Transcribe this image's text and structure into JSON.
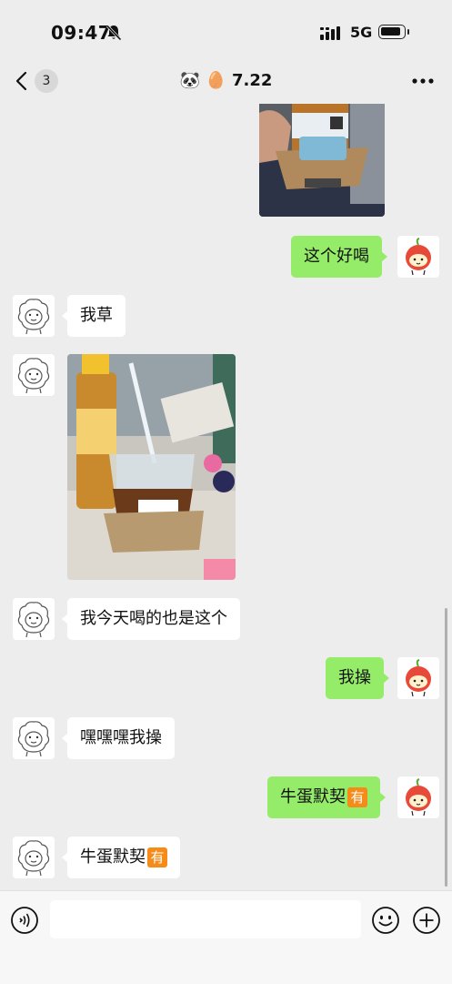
{
  "status_bar": {
    "time": "09:47",
    "network": "5G",
    "battery_level": 0.9
  },
  "nav": {
    "unread_count": "3",
    "title": "🐼 🥚 7.22"
  },
  "messages": [
    {
      "side": "right",
      "type": "text",
      "text": "这个好喝"
    },
    {
      "side": "left",
      "type": "text",
      "text": "我草"
    },
    {
      "side": "left",
      "type": "image"
    },
    {
      "side": "left",
      "type": "text",
      "text": "我今天喝的也是这个"
    },
    {
      "side": "right",
      "type": "text",
      "text": "我操"
    },
    {
      "side": "left",
      "type": "text",
      "text": "嘿嘿嘿我操"
    },
    {
      "side": "right",
      "type": "text",
      "text": "牛蛋默契",
      "emoji": "有"
    },
    {
      "side": "left",
      "type": "text",
      "text": "牛蛋默契",
      "emoji": "有"
    }
  ],
  "input": {
    "value": "",
    "placeholder": ""
  },
  "colors": {
    "background": "#ededed",
    "sent_bubble": "#95ec69",
    "received_bubble": "#ffffff",
    "accent_emoji": "#f58b18"
  },
  "icons": [
    "bell-off-icon",
    "signal-icon",
    "battery-icon",
    "back-icon",
    "more-icon",
    "voice-icon",
    "emoji-icon",
    "plus-icon"
  ]
}
